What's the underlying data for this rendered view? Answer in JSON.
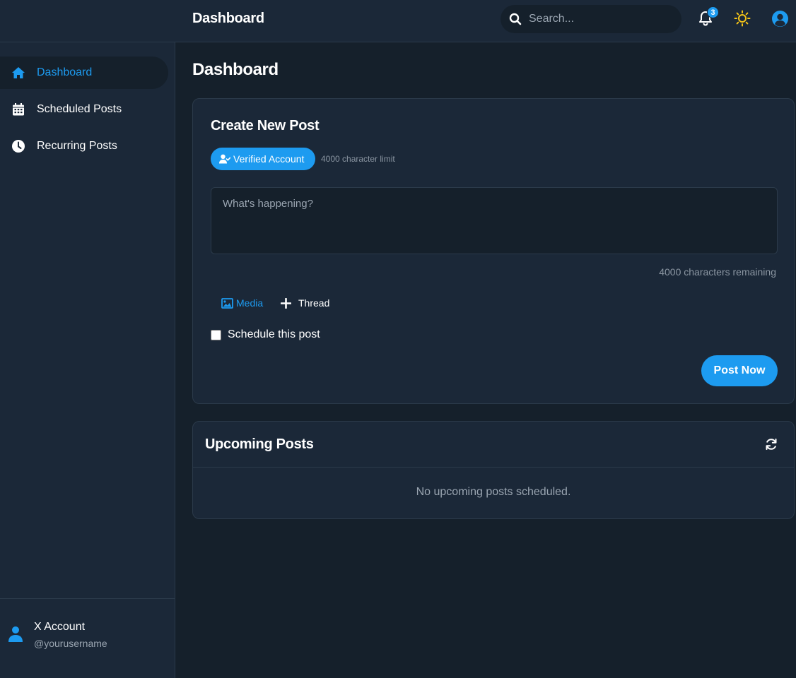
{
  "header": {
    "title": "Dashboard",
    "search_placeholder": "Search...",
    "notification_count": "3",
    "icons": [
      "search-icon",
      "bell-icon",
      "sun-icon",
      "user-circle-icon"
    ]
  },
  "sidebar": {
    "items": [
      {
        "label": "Dashboard",
        "icon": "home-icon",
        "active": true
      },
      {
        "label": "Scheduled Posts",
        "icon": "calendar-icon",
        "active": false
      },
      {
        "label": "Recurring Posts",
        "icon": "clock-icon",
        "active": false
      }
    ],
    "account": {
      "name": "X Account",
      "handle": "@yourusername"
    }
  },
  "main": {
    "title": "Dashboard",
    "create_post": {
      "title": "Create New Post",
      "verified_label": "Verified Account",
      "char_limit": "4000 character limit",
      "placeholder": "What's happening?",
      "chars_remaining": "4000 characters remaining",
      "media_label": "Media",
      "thread_label": "Thread",
      "schedule_label": "Schedule this post",
      "post_button": "Post Now"
    },
    "upcoming": {
      "title": "Upcoming Posts",
      "empty_message": "No upcoming posts scheduled."
    }
  },
  "colors": {
    "accent": "#1d9bf0",
    "background": "#15202b",
    "surface": "#1b2838",
    "border": "#2b3a4a",
    "sun": "#f5c518"
  }
}
